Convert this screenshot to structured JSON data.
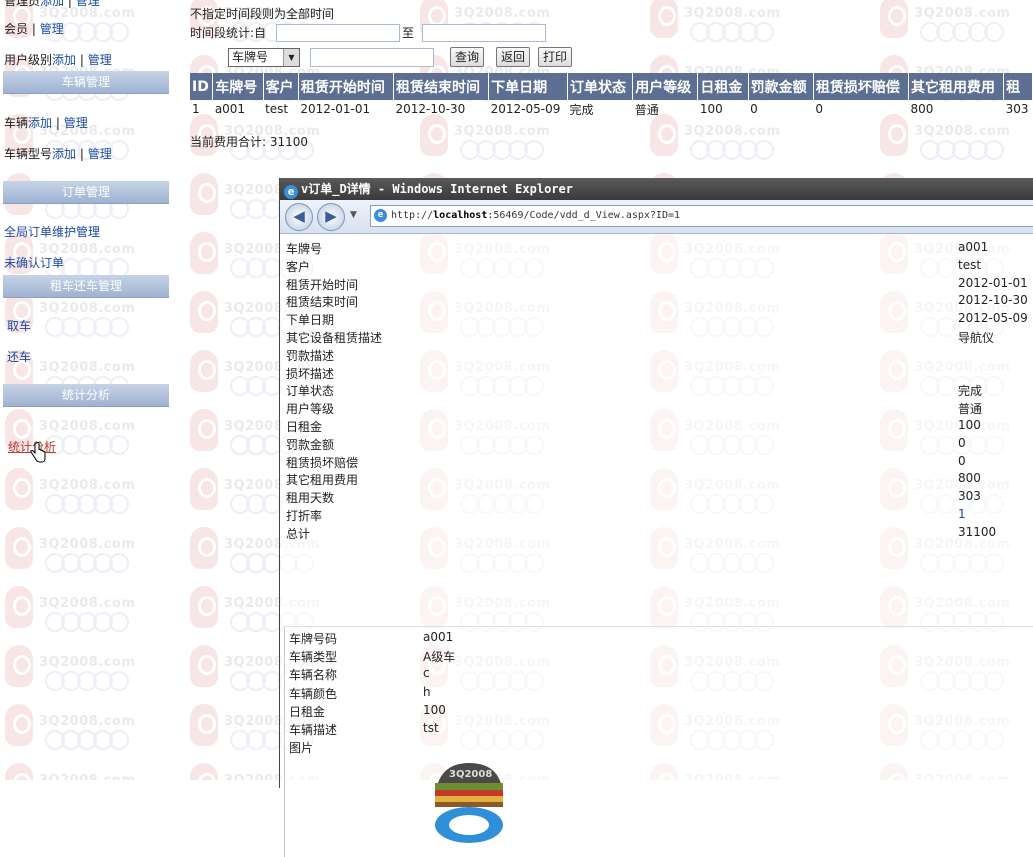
{
  "sidebar": {
    "row_top": {
      "prefix": "管理员",
      "add": "添加",
      "sep": " | ",
      "manage": "管理"
    },
    "members": {
      "prefix": "会员",
      "sep": " | ",
      "manage": "管理"
    },
    "user_level": {
      "prefix": "用户级别",
      "add": "添加",
      "sep": " | ",
      "manage": "管理"
    },
    "section_vehicle": "车辆管理",
    "vehicle": {
      "prefix": "车辆",
      "add": "添加",
      "sep": " | ",
      "manage": "管理"
    },
    "vehicle_type": {
      "prefix": "车辆型号",
      "add": "添加",
      "sep": " | ",
      "manage": "管理"
    },
    "section_orders": "订单管理",
    "global_orders": "全局订单维护管理",
    "unconfirmed": "未确认订单",
    "section_rental": "租车还车管理",
    "pickup": "取车",
    "return": "还车",
    "section_stats": "统计分析",
    "stats_link": "统计分析"
  },
  "filter": {
    "notice": "不指定时间段则为全部时间",
    "range_label": "时间段统计:自",
    "to_label": "至",
    "field_select": "车牌号",
    "query_button": "查询",
    "back_button": "返回",
    "print_button": "打印"
  },
  "table": {
    "headers": [
      "ID",
      "车牌号",
      "客户",
      "租赁开始时间",
      "租赁结束时间",
      "下单日期",
      "订单状态",
      "用户等级",
      "日租金",
      "罚款金额",
      "租赁损坏赔偿",
      "其它租用费用",
      "租"
    ],
    "rows": [
      [
        "1",
        "a001",
        "test",
        "2012-01-01",
        "2012-10-30",
        "2012-05-09",
        "完成",
        "普通",
        "100",
        "0",
        "0",
        "800",
        "303"
      ]
    ]
  },
  "total_text": "当前费用合计: 31100",
  "ie": {
    "title": "v订单_D详情 - Windows Internet Explorer",
    "url_prefix": "http://",
    "url_host": "localhost",
    "url_rest": ":56469/Code/vdd_d_View.aspx?ID=1",
    "nav_back": "◀",
    "nav_forward": "▶",
    "nav_dropdown": "▼",
    "details": [
      {
        "label": "车牌号",
        "value": "a001"
      },
      {
        "label": "客户",
        "value": "test"
      },
      {
        "label": "租赁开始时间",
        "value": "2012-01-01"
      },
      {
        "label": "租赁结束时间",
        "value": "2012-10-30"
      },
      {
        "label": "下单日期",
        "value": "2012-05-09"
      },
      {
        "label": "其它设备租赁描述",
        "value": "导航仪"
      },
      {
        "label": "罚款描述",
        "value": ""
      },
      {
        "label": "损坏描述",
        "value": ""
      },
      {
        "label": "订单状态",
        "value": "完成"
      },
      {
        "label": "用户等级",
        "value": "普通"
      },
      {
        "label": "日租金",
        "value": "100"
      },
      {
        "label": "罚款金额",
        "value": "0"
      },
      {
        "label": "租赁损坏赔偿",
        "value": "0"
      },
      {
        "label": "其它租用费用",
        "value": "800"
      },
      {
        "label": "租用天数",
        "value": "303"
      },
      {
        "label": "打折率",
        "value": "1"
      },
      {
        "label": "总计",
        "value": "31100"
      }
    ],
    "vehicle": [
      {
        "label": "车牌号码",
        "value": "a001"
      },
      {
        "label": "车辆类型",
        "value": "A级车"
      },
      {
        "label": "车辆名称",
        "value": "c"
      },
      {
        "label": "车辆颜色",
        "value": "h"
      },
      {
        "label": "日租金",
        "value": "100"
      },
      {
        "label": "车辆描述",
        "value": "tst"
      },
      {
        "label": "图片",
        "value": ""
      }
    ]
  },
  "watermark": {
    "text": "3Q2008.com"
  },
  "colors": {
    "header_bg": "#5c6f92",
    "link": "#1a4aa6",
    "section_head": "#9eb3d2"
  }
}
